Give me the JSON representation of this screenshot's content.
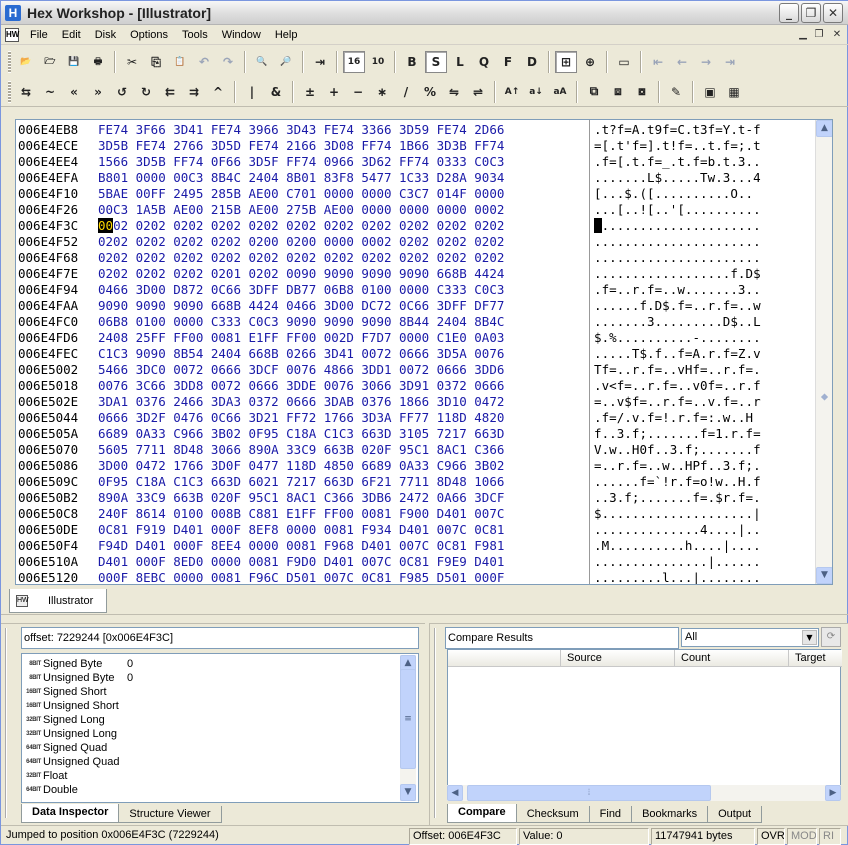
{
  "window": {
    "title": "Hex Workshop - [Illustrator]",
    "app_icon_label": "H"
  },
  "menu": {
    "doc_icon": "HW",
    "items": [
      "File",
      "Edit",
      "Disk",
      "Options",
      "Tools",
      "Window",
      "Help"
    ]
  },
  "toolbar1": [
    {
      "name": "open-icon",
      "glyph": "📂"
    },
    {
      "name": "open-folder-icon",
      "glyph": "🗁"
    },
    {
      "name": "save-icon",
      "glyph": "💾"
    },
    {
      "name": "print-icon",
      "glyph": "🖶"
    },
    {
      "sep": true
    },
    {
      "name": "cut-icon",
      "glyph": "✂"
    },
    {
      "name": "copy-icon",
      "glyph": "⎘"
    },
    {
      "name": "paste-icon",
      "glyph": "📋"
    },
    {
      "name": "undo-icon",
      "glyph": "↶",
      "dim": true
    },
    {
      "name": "redo-icon",
      "glyph": "↷",
      "dim": true
    },
    {
      "sep": true
    },
    {
      "name": "find-icon",
      "glyph": "🔍"
    },
    {
      "name": "find-next-icon",
      "glyph": "🔎"
    },
    {
      "sep": true
    },
    {
      "name": "goto-icon",
      "glyph": "⇥"
    },
    {
      "sep": true
    },
    {
      "name": "hex-mode-icon",
      "glyph": "16",
      "pressed": true
    },
    {
      "name": "dec-mode-icon",
      "glyph": "10"
    },
    {
      "sep": true
    },
    {
      "name": "byte-mode-button",
      "glyph": "B"
    },
    {
      "name": "short-mode-button",
      "glyph": "S",
      "pressed": true
    },
    {
      "name": "long-mode-button",
      "glyph": "L"
    },
    {
      "name": "quad-mode-button",
      "glyph": "Q"
    },
    {
      "name": "float-mode-button",
      "glyph": "F"
    },
    {
      "name": "double-mode-button",
      "glyph": "D"
    },
    {
      "sep": true
    },
    {
      "name": "compare-icon",
      "glyph": "⊞",
      "pressed": true
    },
    {
      "name": "checksum-icon",
      "glyph": "⊕"
    },
    {
      "sep": true
    },
    {
      "name": "window-icon",
      "glyph": "▭"
    },
    {
      "sep": true
    },
    {
      "name": "first-bookmark-icon",
      "glyph": "⇤",
      "dim": true
    },
    {
      "name": "prev-bookmark-icon",
      "glyph": "←",
      "dim": true
    },
    {
      "name": "next-bookmark-icon",
      "glyph": "→",
      "dim": true
    },
    {
      "name": "last-bookmark-icon",
      "glyph": "⇥",
      "dim": true
    }
  ],
  "toolbar2": [
    {
      "name": "swap-icon",
      "glyph": "⇆"
    },
    {
      "name": "not-icon",
      "glyph": "~"
    },
    {
      "name": "shift-left-icon",
      "glyph": "«"
    },
    {
      "name": "shift-right-icon",
      "glyph": "»"
    },
    {
      "name": "rotate-left-icon",
      "glyph": "↺"
    },
    {
      "name": "rotate-right-icon",
      "glyph": "↻"
    },
    {
      "name": "block-shift-left-icon",
      "glyph": "⇇"
    },
    {
      "name": "block-shift-right-icon",
      "glyph": "⇉"
    },
    {
      "name": "xor-icon",
      "glyph": "^"
    },
    {
      "sep": true
    },
    {
      "name": "or-icon",
      "glyph": "|"
    },
    {
      "name": "and-icon",
      "glyph": "&"
    },
    {
      "sep": true
    },
    {
      "name": "negate-icon",
      "glyph": "±"
    },
    {
      "name": "add-icon",
      "glyph": "+"
    },
    {
      "name": "subtract-icon",
      "glyph": "−"
    },
    {
      "name": "multiply-icon",
      "glyph": "∗"
    },
    {
      "name": "divide-icon",
      "glyph": "/"
    },
    {
      "name": "modulus-icon",
      "glyph": "%"
    },
    {
      "name": "reverse-icon",
      "glyph": "⇋"
    },
    {
      "name": "reverse-block-icon",
      "glyph": "⇌"
    },
    {
      "sep": true
    },
    {
      "name": "uppercase-icon",
      "glyph": "A↑"
    },
    {
      "name": "lowercase-icon",
      "glyph": "a↓"
    },
    {
      "name": "invert-case-icon",
      "glyph": "aA"
    },
    {
      "sep": true
    },
    {
      "name": "structure-icon",
      "glyph": "⧉"
    },
    {
      "name": "struct-add-icon",
      "glyph": "⧈"
    },
    {
      "name": "struct-remove-icon",
      "glyph": "⧇"
    },
    {
      "sep": true
    },
    {
      "name": "generate-icon",
      "glyph": "✎"
    },
    {
      "sep": true
    },
    {
      "name": "chip-icon",
      "glyph": "▣"
    },
    {
      "name": "calculator-icon",
      "glyph": "▦"
    }
  ],
  "hex": {
    "rows": [
      {
        "off": "006E4EB8",
        "hex": "FE74 3F66 3D41 FE74 3966 3D43 FE74 3366 3D59 FE74 2D66",
        "ascii": ".t?f=A.t9f=C.t3f=Y.t-f"
      },
      {
        "off": "006E4ECE",
        "hex": "3D5B FE74 2766 3D5D FE74 2166 3D08 FF74 1B66 3D3B FF74",
        "ascii": "=[.t'f=].t!f=..t.f=;.t"
      },
      {
        "off": "006E4EE4",
        "hex": "1566 3D5B FF74 0F66 3D5F FF74 0966 3D62 FF74 0333 C0C3",
        "ascii": ".f=[.t.f=_.t.f=b.t.3.."
      },
      {
        "off": "006E4EFA",
        "hex": "B801 0000 00C3 8B4C 2404 8B01 83F8 5477 1C33 D28A 9034",
        "ascii": ".......L$.....Tw.3...4"
      },
      {
        "off": "006E4F10",
        "hex": "5BAE 00FF 2495 285B AE00 C701 0000 0000 C3C7 014F 0000",
        "ascii": "[...$.([..........O.."
      },
      {
        "off": "006E4F26",
        "hex": "00C3 1A5B AE00 215B AE00 275B AE00 0000 0000 0000 0002",
        "ascii": "...[..![..'[.........."
      },
      {
        "off": "006E4F3C",
        "hex": "0002 0202 0202 0202 0202 0202 0202 0202 0202 0202 0202",
        "ascii": "......................",
        "caret": true
      },
      {
        "off": "006E4F52",
        "hex": "0202 0202 0202 0202 0200 0200 0000 0002 0202 0202 0202",
        "ascii": "......................"
      },
      {
        "off": "006E4F68",
        "hex": "0202 0202 0202 0202 0202 0202 0202 0202 0202 0202 0202",
        "ascii": "......................"
      },
      {
        "off": "006E4F7E",
        "hex": "0202 0202 0202 0201 0202 0090 9090 9090 9090 668B 4424",
        "ascii": "..................f.D$"
      },
      {
        "off": "006E4F94",
        "hex": "0466 3D00 D872 0C66 3DFF DB77 06B8 0100 0000 C333 C0C3",
        "ascii": ".f=..r.f=..w.......3.."
      },
      {
        "off": "006E4FAA",
        "hex": "9090 9090 9090 668B 4424 0466 3D00 DC72 0C66 3DFF DF77",
        "ascii": "......f.D$.f=..r.f=..w"
      },
      {
        "off": "006E4FC0",
        "hex": "06B8 0100 0000 C333 C0C3 9090 9090 9090 8B44 2404 8B4C",
        "ascii": ".......3.........D$..L"
      },
      {
        "off": "006E4FD6",
        "hex": "2408 25FF FF00 0081 E1FF FF00 002D F7D7 0000 C1E0 0A03",
        "ascii": "$.%..........-........"
      },
      {
        "off": "006E4FEC",
        "hex": "C1C3 9090 8B54 2404 668B 0266 3D41 0072 0666 3D5A 0076",
        "ascii": ".....T$.f..f=A.r.f=Z.v"
      },
      {
        "off": "006E5002",
        "hex": "5466 3DC0 0072 0666 3DCF 0076 4866 3DD1 0072 0666 3DD6",
        "ascii": "Tf=..r.f=..vHf=..r.f=."
      },
      {
        "off": "006E5018",
        "hex": "0076 3C66 3DD8 0072 0666 3DDE 0076 3066 3D91 0372 0666",
        "ascii": ".v<f=..r.f=..v0f=..r.f"
      },
      {
        "off": "006E502E",
        "hex": "3DA1 0376 2466 3DA3 0372 0666 3DAB 0376 1866 3D10 0472",
        "ascii": "=..v$f=..r.f=..v.f=..r"
      },
      {
        "off": "006E5044",
        "hex": "0666 3D2F 0476 0C66 3D21 FF72 1766 3D3A FF77 118D 4820",
        "ascii": ".f=/.v.f=!.r.f=:.w..H "
      },
      {
        "off": "006E505A",
        "hex": "6689 0A33 C966 3B02 0F95 C18A C1C3 663D 3105 7217 663D",
        "ascii": "f..3.f;.......f=1.r.f="
      },
      {
        "off": "006E5070",
        "hex": "5605 7711 8D48 3066 890A 33C9 663B 020F 95C1 8AC1 C366",
        "ascii": "V.w..H0f..3.f;.......f"
      },
      {
        "off": "006E5086",
        "hex": "3D00 0472 1766 3D0F 0477 118D 4850 6689 0A33 C966 3B02",
        "ascii": "=..r.f=..w..HPf..3.f;."
      },
      {
        "off": "006E509C",
        "hex": "0F95 C18A C1C3 663D 6021 7217 663D 6F21 7711 8D48 1066",
        "ascii": "......f=`!r.f=o!w..H.f"
      },
      {
        "off": "006E50B2",
        "hex": "890A 33C9 663B 020F 95C1 8AC1 C366 3DB6 2472 0A66 3DCF",
        "ascii": "..3.f;.......f=.$r.f=."
      },
      {
        "off": "006E50C8",
        "hex": "240F 8614 0100 008B C881 E1FF FF00 0081 F900 D401 007C",
        "ascii": "$....................|"
      },
      {
        "off": "006E50DE",
        "hex": "0C81 F919 D401 000F 8EF8 0000 0081 F934 D401 007C 0C81",
        "ascii": "..............4....|.."
      },
      {
        "off": "006E50F4",
        "hex": "F94D D401 000F 8EE4 0000 0081 F968 D401 007C 0C81 F981",
        "ascii": ".M..........h....|...."
      },
      {
        "off": "006E510A",
        "hex": "D401 000F 8ED0 0000 0081 F9D0 D401 007C 0C81 F9E9 D401",
        "ascii": "...............|......"
      },
      {
        "off": "006E5120",
        "hex": "000F 8EBC 0000 0081 F96C D501 007C 0C81 F985 D501 000F",
        "ascii": ".........l...|........"
      }
    ]
  },
  "doc_tab": {
    "label": "Illustrator",
    "icon": "HW"
  },
  "inspector": {
    "offset_label": "offset: 7229244 [0x006E4F3C]",
    "rows": [
      {
        "bits": "8BIT",
        "name": "Signed Byte",
        "value": "0"
      },
      {
        "bits": "8BIT",
        "name": "Unsigned Byte",
        "value": "0"
      },
      {
        "bits": "16BIT",
        "name": "Signed Short",
        "value": ""
      },
      {
        "bits": "16BIT",
        "name": "Unsigned Short",
        "value": ""
      },
      {
        "bits": "32BIT",
        "name": "Signed Long",
        "value": ""
      },
      {
        "bits": "32BIT",
        "name": "Unsigned Long",
        "value": ""
      },
      {
        "bits": "64BIT",
        "name": "Signed Quad",
        "value": ""
      },
      {
        "bits": "64BIT",
        "name": "Unsigned Quad",
        "value": ""
      },
      {
        "bits": "32BIT",
        "name": "Float",
        "value": ""
      },
      {
        "bits": "64BIT",
        "name": "Double",
        "value": ""
      }
    ],
    "tabs": [
      "Data Inspector",
      "Structure Viewer"
    ]
  },
  "compare": {
    "header_label": "Compare Results",
    "filter_value": "All",
    "columns": [
      "Source",
      "Count",
      "Target"
    ],
    "tabs": [
      "Compare",
      "Checksum",
      "Find",
      "Bookmarks",
      "Output"
    ]
  },
  "status": {
    "message": "Jumped to position 0x006E4F3C (7229244)",
    "offset": "Offset: 006E4F3C",
    "value": "Value: 0",
    "size": "11747941 bytes",
    "ovr": "OVR",
    "mod": "MOD",
    "ri": "RI"
  }
}
